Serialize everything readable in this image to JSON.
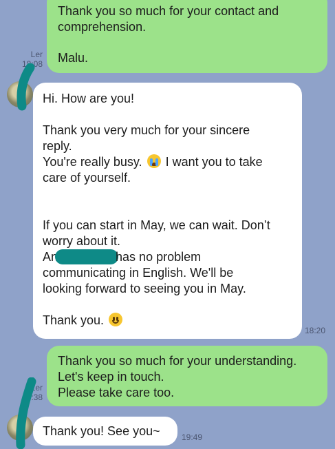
{
  "messages": {
    "m1": {
      "lines": "Thank you so much for your contact and\ncomprehension.",
      "signature": "Malu.",
      "read_label": "Ler",
      "time": "18:08"
    },
    "m2": {
      "greeting": "Hi. How are you!",
      "p1": "Thank you very much for your sincere\nreply.",
      "p2a": "You're really busy.",
      "p2b": "I want you to take\ncare of yourself.",
      "p3": "If you can start in May, we can wait. Don’t\nworry about it.",
      "p4a": "An",
      "p4b": "has no problem\ncommunicating in English. We'll be\nlooking forward to seeing you in May.",
      "p5": "Thank you.",
      "time": "18:20"
    },
    "m3": {
      "lines": "Thank you so much for your understanding.\nLet's keep in touch.\nPlease take care too.",
      "read_label": "Ler",
      "time": "19:38"
    },
    "m4": {
      "text": "Thank you! See you~",
      "time": "19:49"
    }
  },
  "icons": {
    "cry": "crying-face-icon",
    "smile": "smiling-face-icon"
  },
  "colors": {
    "background": "#8fa2c9",
    "outgoing_bubble": "#9ce28a",
    "incoming_bubble": "#ffffff",
    "redaction": "#0e8a87"
  }
}
